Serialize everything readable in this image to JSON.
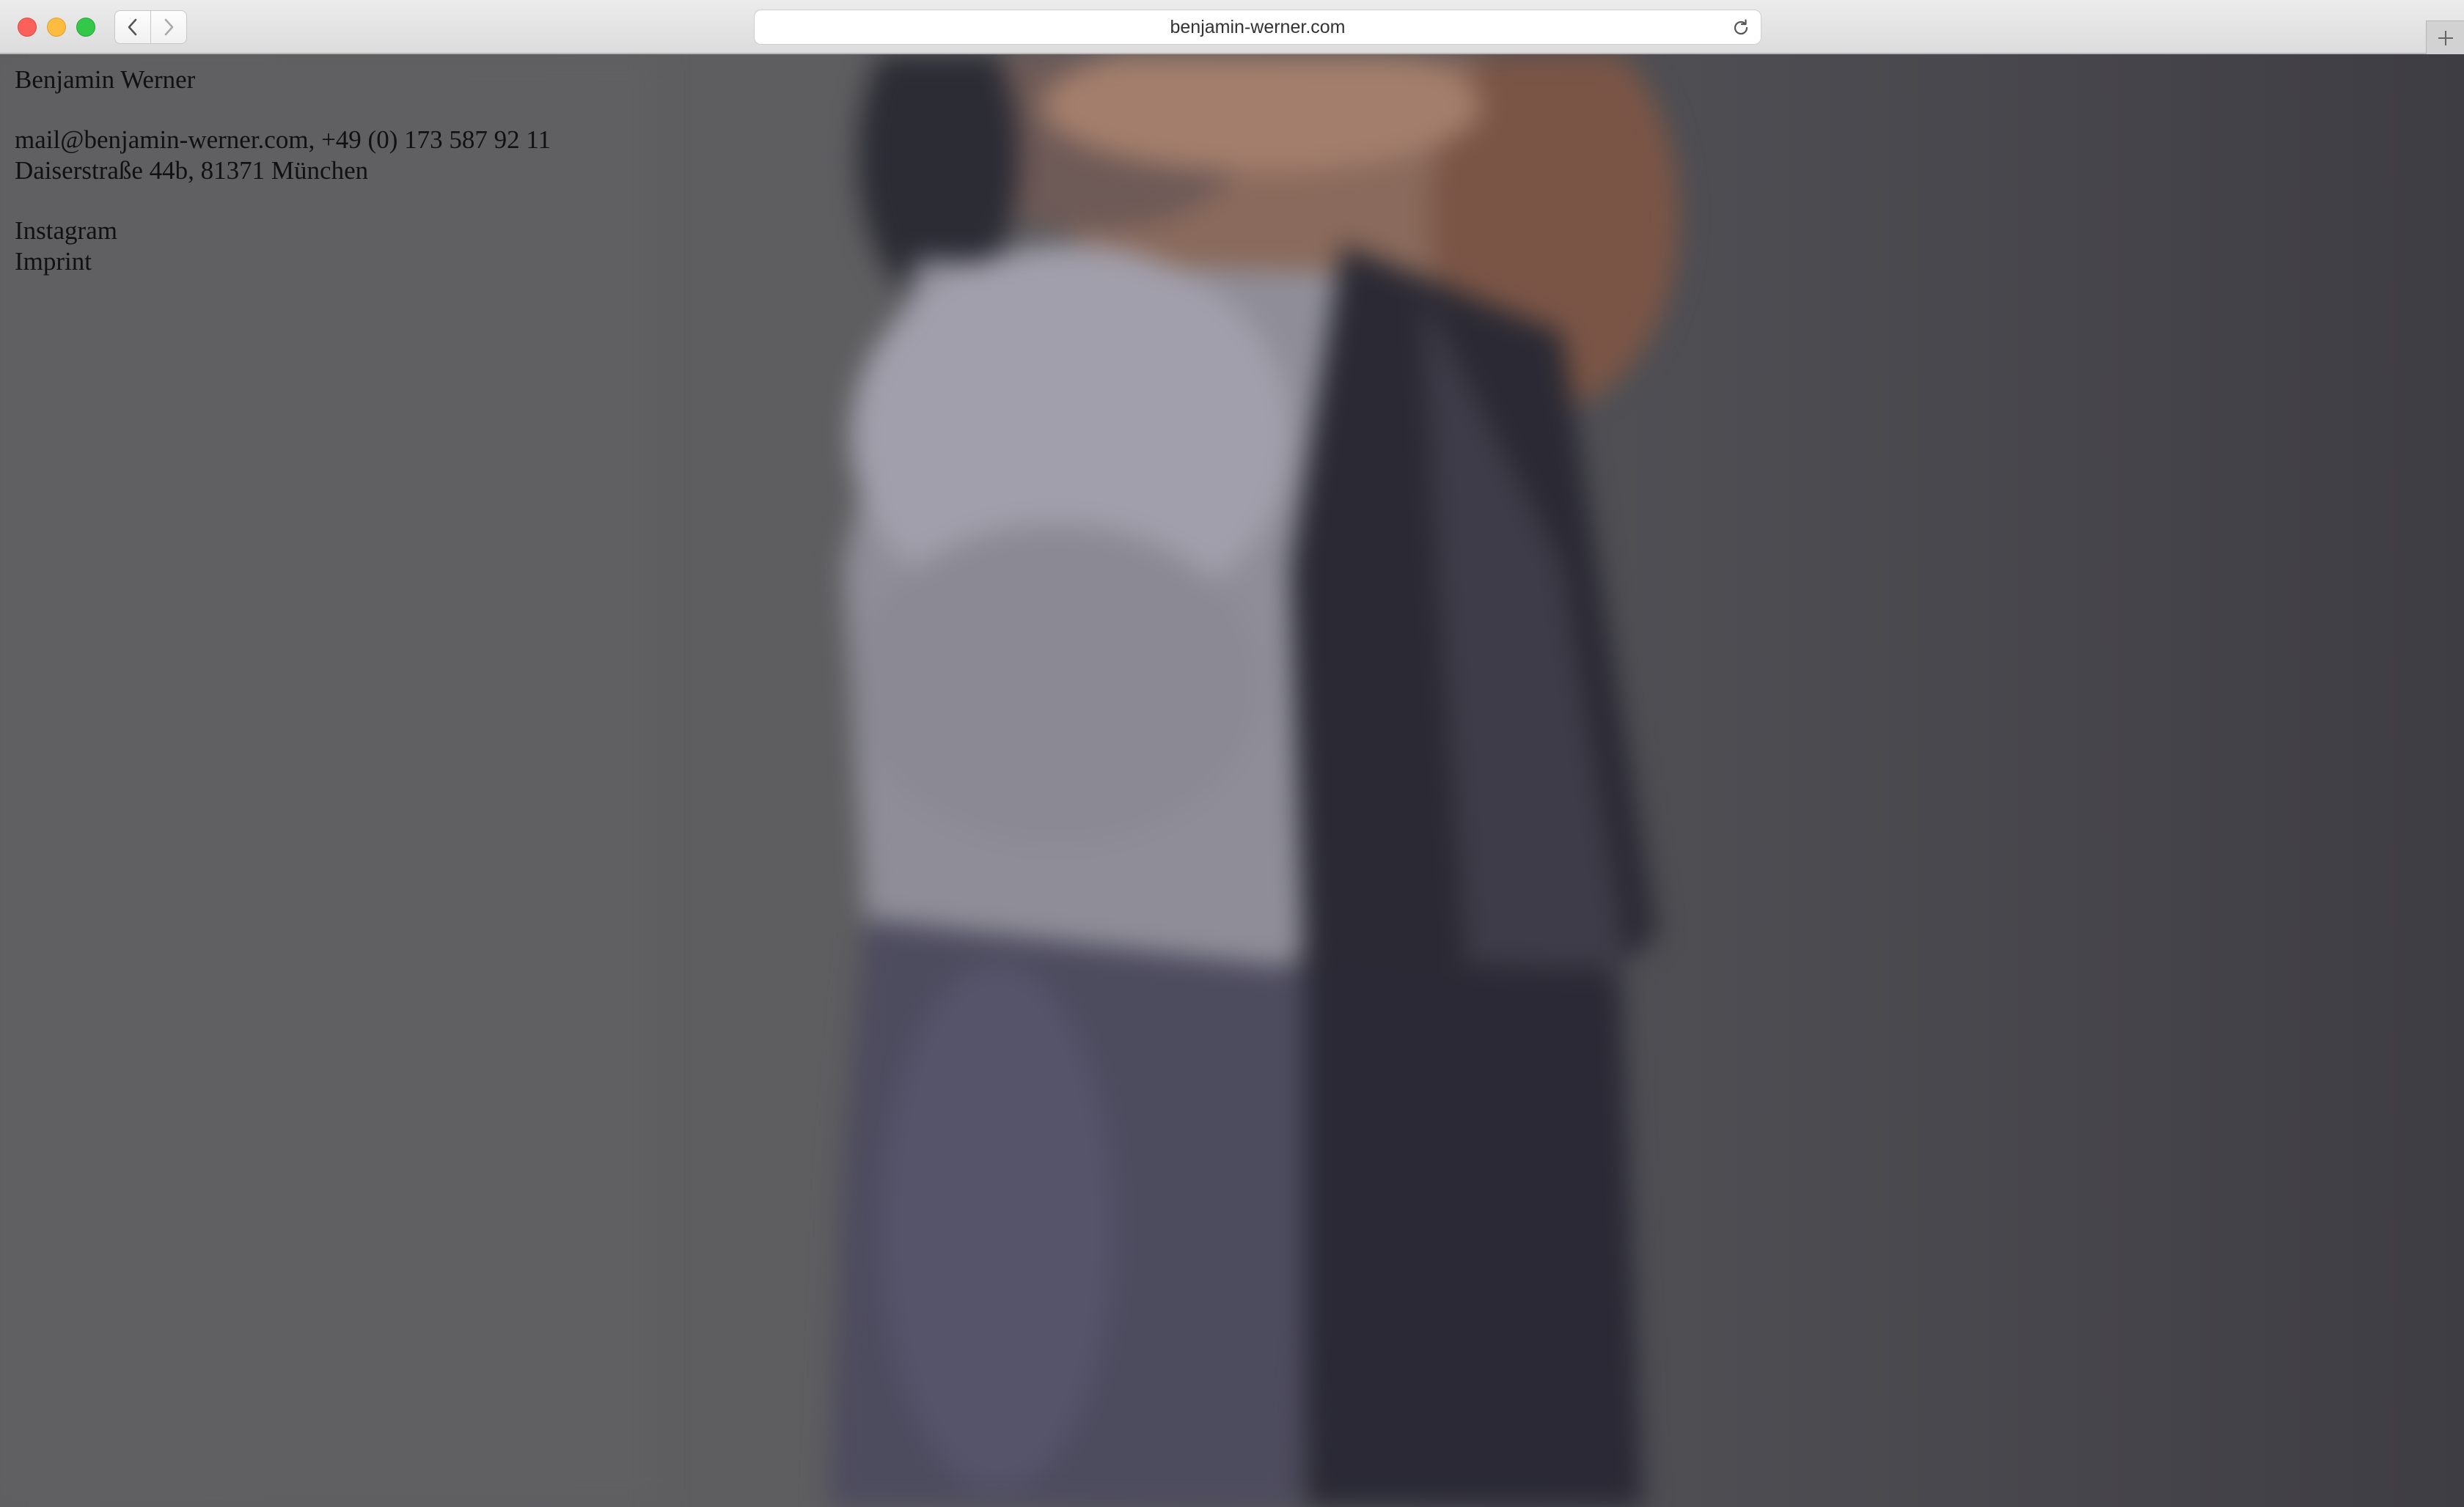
{
  "browser": {
    "url": "benjamin-werner.com"
  },
  "site": {
    "name": "Benjamin Werner",
    "contact_line": "mail@benjamin-werner.com, +49 (0) 173 587 92 11",
    "address_line": "Daiserstraße 44b, 81371 München",
    "links": {
      "instagram": "Instagram",
      "imprint": "Imprint"
    }
  },
  "icons": {
    "back": "chevron-left-icon",
    "forward": "chevron-right-icon",
    "reload": "reload-icon",
    "new_tab": "plus-icon"
  },
  "colors": {
    "close": "#fc605b",
    "minimize": "#fdbc40",
    "maximize": "#34c84a",
    "text": "#111111"
  }
}
